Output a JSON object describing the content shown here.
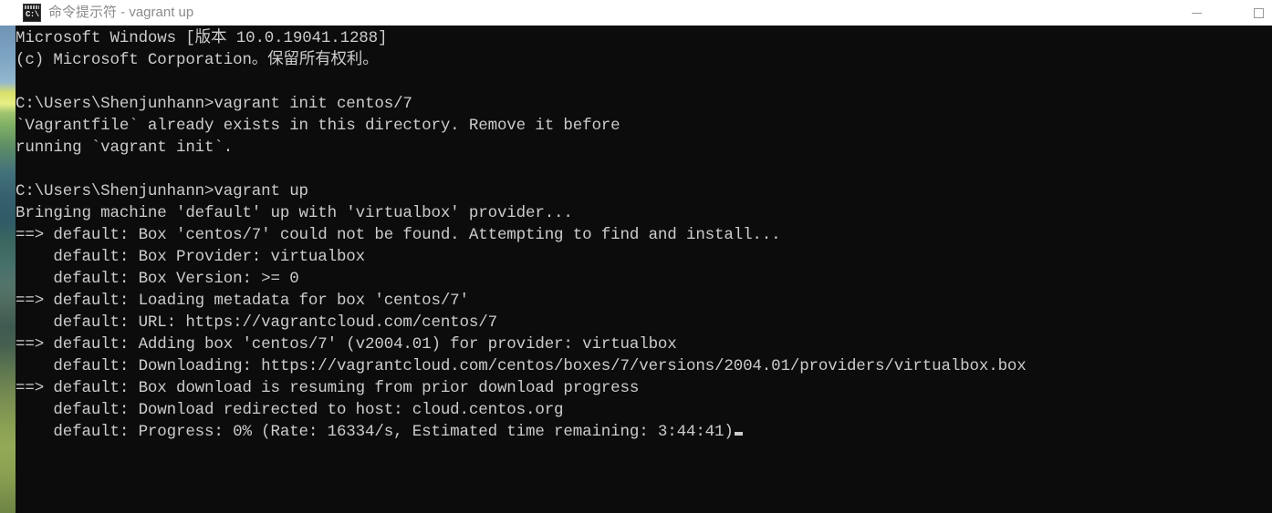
{
  "window": {
    "title": "命令提示符 - vagrant up",
    "icon": "cmd-icon",
    "icon_text": "C:\\",
    "controls": {
      "minimize_label": "—",
      "maximize_label": "□",
      "close_label": "✕"
    }
  },
  "console": {
    "background_color": "#0c0c0c",
    "text_color": "#cccccc",
    "lines": [
      "Microsoft Windows [版本 10.0.19041.1288]",
      "(c) Microsoft Corporation。保留所有权利。",
      "",
      "C:\\Users\\Shenjunhann>vagrant init centos/7",
      "`Vagrantfile` already exists in this directory. Remove it before",
      "running `vagrant init`.",
      "",
      "C:\\Users\\Shenjunhann>vagrant up",
      "Bringing machine 'default' up with 'virtualbox' provider...",
      "==> default: Box 'centos/7' could not be found. Attempting to find and install...",
      "    default: Box Provider: virtualbox",
      "    default: Box Version: >= 0",
      "==> default: Loading metadata for box 'centos/7'",
      "    default: URL: https://vagrantcloud.com/centos/7",
      "==> default: Adding box 'centos/7' (v2004.01) for provider: virtualbox",
      "    default: Downloading: https://vagrantcloud.com/centos/boxes/7/versions/2004.01/providers/virtualbox.box",
      "==> default: Box download is resuming from prior download progress",
      "    default: Download redirected to host: cloud.centos.org",
      "    default: Progress: 0% (Rate: 16334/s, Estimated time remaining: 3:44:41)"
    ],
    "cursor_line_index": 18,
    "status": {
      "progress_percent": "0%",
      "rate": "16334/s",
      "estimated_time_remaining": "3:44:41",
      "box_name": "centos/7",
      "box_version": "v2004.01",
      "box_provider": "virtualbox",
      "redirect_host": "cloud.centos.org"
    }
  },
  "desktop": {
    "wallpaper_visible": true
  }
}
